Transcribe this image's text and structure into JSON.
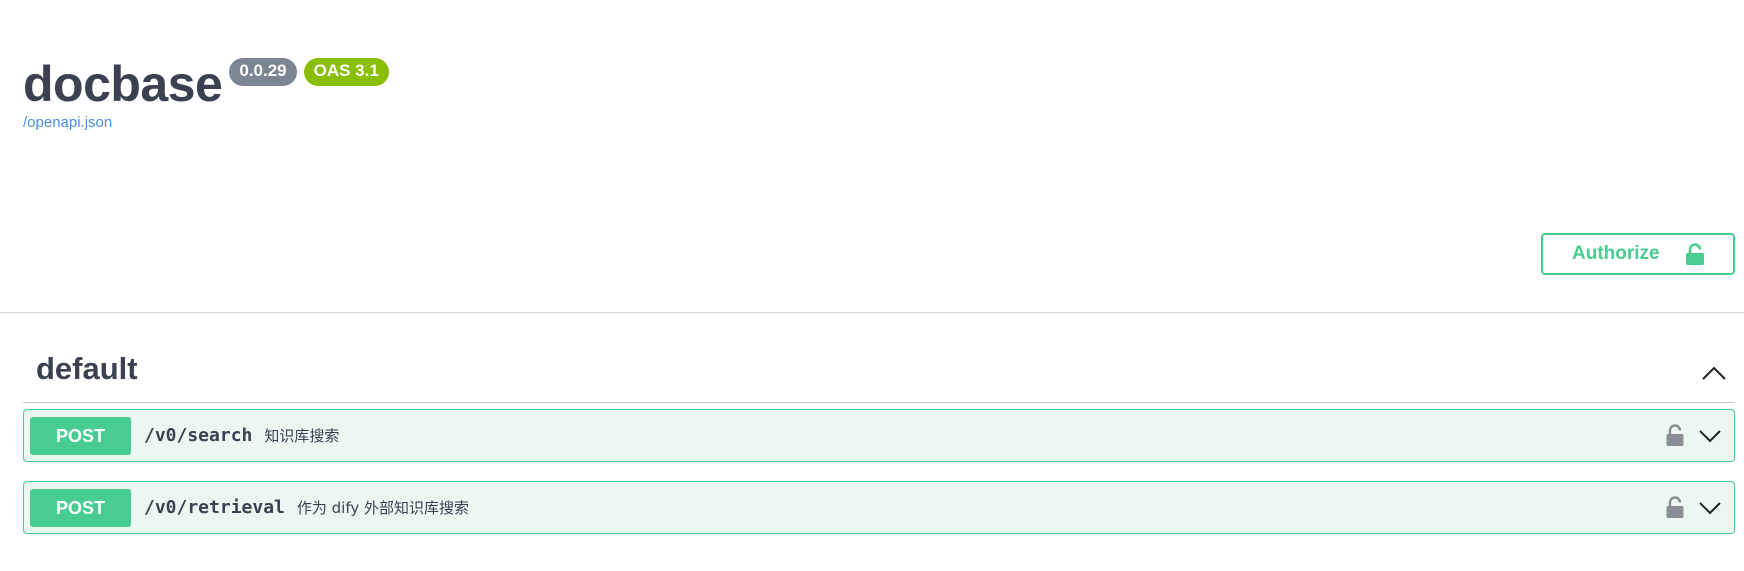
{
  "info": {
    "title": "docbase",
    "version": "0.0.29",
    "oas_version": "OAS 3.1",
    "spec_link": "/openapi.json"
  },
  "authorize": {
    "label": "Authorize",
    "icon": "unlocked-lock-icon"
  },
  "tag": {
    "name": "default",
    "toggle_icon": "chevron-up-icon"
  },
  "operations": [
    {
      "method": "POST",
      "path": "/v0/search",
      "summary": "知识库搜索",
      "lock_icon": "lock-icon",
      "expand_icon": "chevron-down-icon"
    },
    {
      "method": "POST",
      "path": "/v0/retrieval",
      "summary": "作为 dify 外部知识库搜索",
      "lock_icon": "lock-icon",
      "expand_icon": "chevron-down-icon"
    }
  ],
  "colors": {
    "post": "#49cc90",
    "post_bg": "#ebf8f2",
    "version_badge": "#7d8492",
    "oas_badge": "#89bf04",
    "link": "#4990e2",
    "text": "#3b4151"
  }
}
